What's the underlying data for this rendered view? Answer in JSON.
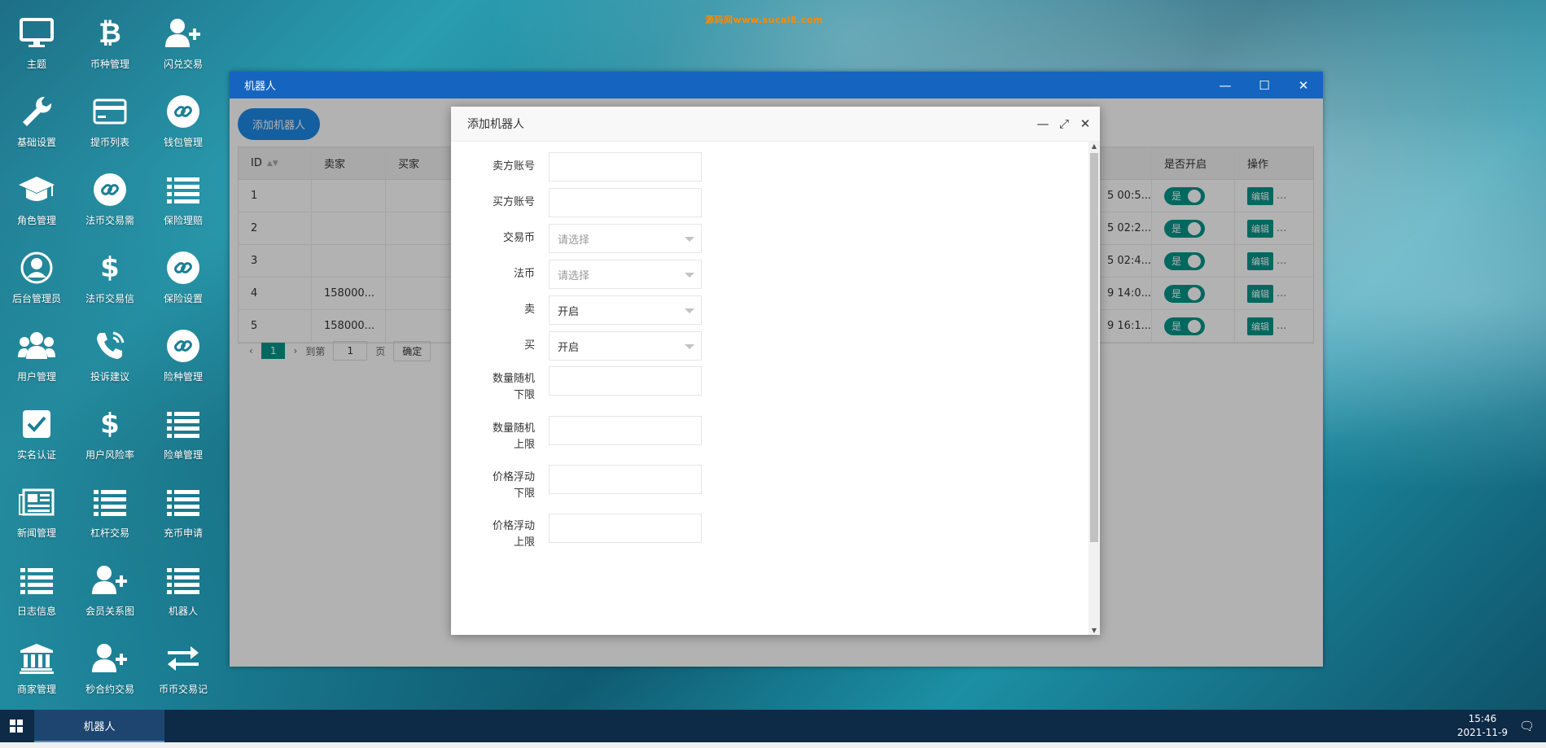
{
  "watermark": "源码网www.sucai8.com",
  "desktop_icons": [
    {
      "label": "主题",
      "icon": "monitor-icon"
    },
    {
      "label": "币种管理",
      "icon": "bitcoin-icon"
    },
    {
      "label": "闪兑交易",
      "icon": "user-plus-icon"
    },
    {
      "label": "基础设置",
      "icon": "wrench-icon"
    },
    {
      "label": "提币列表",
      "icon": "credit-card-icon"
    },
    {
      "label": "钱包管理",
      "icon": "link-circle-icon"
    },
    {
      "label": "角色管理",
      "icon": "graduation-cap-icon"
    },
    {
      "label": "法币交易需",
      "icon": "link-circle-icon"
    },
    {
      "label": "保险理赔",
      "icon": "list-icon"
    },
    {
      "label": "后台管理员",
      "icon": "user-circle-icon"
    },
    {
      "label": "法币交易信",
      "icon": "dollar-icon"
    },
    {
      "label": "保险设置",
      "icon": "link-circle-icon"
    },
    {
      "label": "用户管理",
      "icon": "users-icon"
    },
    {
      "label": "投诉建议",
      "icon": "phone-icon"
    },
    {
      "label": "险种管理",
      "icon": "link-circle-icon"
    },
    {
      "label": "实名认证",
      "icon": "checkbox-icon"
    },
    {
      "label": "用户风险率",
      "icon": "dollar-icon"
    },
    {
      "label": "险单管理",
      "icon": "list-icon"
    },
    {
      "label": "新闻管理",
      "icon": "newspaper-icon"
    },
    {
      "label": "杠杆交易",
      "icon": "list-icon"
    },
    {
      "label": "充币申请",
      "icon": "list-icon"
    },
    {
      "label": "日志信息",
      "icon": "list-icon"
    },
    {
      "label": "会员关系图",
      "icon": "user-plus-icon"
    },
    {
      "label": "机器人",
      "icon": "list-icon"
    },
    {
      "label": "商家管理",
      "icon": "bank-icon"
    },
    {
      "label": "秒合约交易",
      "icon": "user-plus-icon"
    },
    {
      "label": "币币交易记",
      "icon": "exchange-icon"
    }
  ],
  "window": {
    "title": "机器人",
    "add_button": "添加机器人",
    "columns": {
      "id": "ID",
      "seller": "卖家",
      "buyer": "买家",
      "open": "是否开启",
      "op": "操作"
    },
    "rows": [
      {
        "id": "1",
        "seller": "",
        "buyer": "",
        "time": "5 00:5...",
        "open": "是",
        "edit": "编辑",
        "more": "..."
      },
      {
        "id": "2",
        "seller": "",
        "buyer": "",
        "time": "5 02:2...",
        "open": "是",
        "edit": "编辑",
        "more": "..."
      },
      {
        "id": "3",
        "seller": "",
        "buyer": "",
        "time": "5 02:4...",
        "open": "是",
        "edit": "编辑",
        "more": "..."
      },
      {
        "id": "4",
        "seller": "158000...",
        "buyer": "",
        "time": "9 14:0...",
        "open": "是",
        "edit": "编辑",
        "more": "..."
      },
      {
        "id": "5",
        "seller": "158000...",
        "buyer": "",
        "time": "9 16:1...",
        "open": "是",
        "edit": "编辑",
        "more": "..."
      }
    ],
    "pager": {
      "prev": "‹",
      "current": "1",
      "next": "›",
      "goto": "到第",
      "page_value": "1",
      "page_unit": "页",
      "confirm": "确定"
    }
  },
  "modal": {
    "title": "添加机器人",
    "fields": [
      {
        "label": "卖方账号",
        "value": "",
        "type": "input"
      },
      {
        "label": "买方账号",
        "value": "",
        "type": "input"
      },
      {
        "label": "交易币",
        "value": "请选择",
        "type": "select",
        "placeholder": true
      },
      {
        "label": "法币",
        "value": "请选择",
        "type": "select",
        "placeholder": true
      },
      {
        "label": "卖",
        "value": "开启",
        "type": "select"
      },
      {
        "label": "买",
        "value": "开启",
        "type": "select"
      },
      {
        "label": "数量随机下限",
        "value": "",
        "type": "input"
      },
      {
        "label": "数量随机上限",
        "value": "",
        "type": "input"
      },
      {
        "label": "价格浮动下限",
        "value": "",
        "type": "input"
      },
      {
        "label": "价格浮动上限",
        "value": "",
        "type": "input"
      }
    ]
  },
  "taskbar": {
    "task": "机器人",
    "time": "15:46",
    "date": "2021-11-9"
  }
}
